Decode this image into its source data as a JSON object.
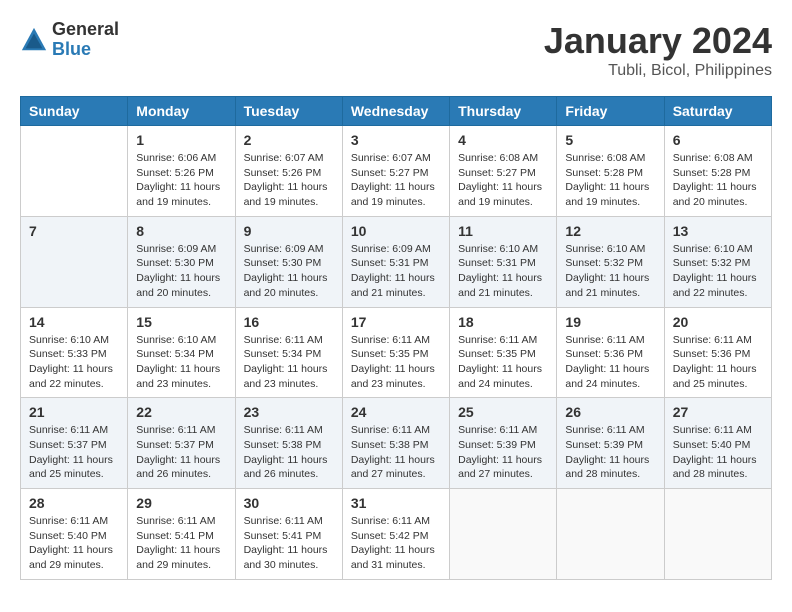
{
  "logo": {
    "general": "General",
    "blue": "Blue"
  },
  "title": {
    "month_year": "January 2024",
    "location": "Tubli, Bicol, Philippines"
  },
  "days_of_week": [
    "Sunday",
    "Monday",
    "Tuesday",
    "Wednesday",
    "Thursday",
    "Friday",
    "Saturday"
  ],
  "weeks": [
    [
      {
        "day": "",
        "sunrise": "",
        "sunset": "",
        "daylight": ""
      },
      {
        "day": "1",
        "sunrise": "Sunrise: 6:06 AM",
        "sunset": "Sunset: 5:26 PM",
        "daylight": "Daylight: 11 hours and 19 minutes."
      },
      {
        "day": "2",
        "sunrise": "Sunrise: 6:07 AM",
        "sunset": "Sunset: 5:26 PM",
        "daylight": "Daylight: 11 hours and 19 minutes."
      },
      {
        "day": "3",
        "sunrise": "Sunrise: 6:07 AM",
        "sunset": "Sunset: 5:27 PM",
        "daylight": "Daylight: 11 hours and 19 minutes."
      },
      {
        "day": "4",
        "sunrise": "Sunrise: 6:08 AM",
        "sunset": "Sunset: 5:27 PM",
        "daylight": "Daylight: 11 hours and 19 minutes."
      },
      {
        "day": "5",
        "sunrise": "Sunrise: 6:08 AM",
        "sunset": "Sunset: 5:28 PM",
        "daylight": "Daylight: 11 hours and 19 minutes."
      },
      {
        "day": "6",
        "sunrise": "Sunrise: 6:08 AM",
        "sunset": "Sunset: 5:28 PM",
        "daylight": "Daylight: 11 hours and 20 minutes."
      }
    ],
    [
      {
        "day": "7",
        "sunrise": "",
        "sunset": "",
        "daylight": ""
      },
      {
        "day": "8",
        "sunrise": "Sunrise: 6:09 AM",
        "sunset": "Sunset: 5:30 PM",
        "daylight": "Daylight: 11 hours and 20 minutes."
      },
      {
        "day": "9",
        "sunrise": "Sunrise: 6:09 AM",
        "sunset": "Sunset: 5:30 PM",
        "daylight": "Daylight: 11 hours and 20 minutes."
      },
      {
        "day": "10",
        "sunrise": "Sunrise: 6:09 AM",
        "sunset": "Sunset: 5:31 PM",
        "daylight": "Daylight: 11 hours and 21 minutes."
      },
      {
        "day": "11",
        "sunrise": "Sunrise: 6:10 AM",
        "sunset": "Sunset: 5:31 PM",
        "daylight": "Daylight: 11 hours and 21 minutes."
      },
      {
        "day": "12",
        "sunrise": "Sunrise: 6:10 AM",
        "sunset": "Sunset: 5:32 PM",
        "daylight": "Daylight: 11 hours and 21 minutes."
      },
      {
        "day": "13",
        "sunrise": "Sunrise: 6:10 AM",
        "sunset": "Sunset: 5:32 PM",
        "daylight": "Daylight: 11 hours and 22 minutes."
      }
    ],
    [
      {
        "day": "14",
        "sunrise": "Sunrise: 6:10 AM",
        "sunset": "Sunset: 5:33 PM",
        "daylight": "Daylight: 11 hours and 22 minutes."
      },
      {
        "day": "15",
        "sunrise": "Sunrise: 6:10 AM",
        "sunset": "Sunset: 5:34 PM",
        "daylight": "Daylight: 11 hours and 23 minutes."
      },
      {
        "day": "16",
        "sunrise": "Sunrise: 6:11 AM",
        "sunset": "Sunset: 5:34 PM",
        "daylight": "Daylight: 11 hours and 23 minutes."
      },
      {
        "day": "17",
        "sunrise": "Sunrise: 6:11 AM",
        "sunset": "Sunset: 5:35 PM",
        "daylight": "Daylight: 11 hours and 23 minutes."
      },
      {
        "day": "18",
        "sunrise": "Sunrise: 6:11 AM",
        "sunset": "Sunset: 5:35 PM",
        "daylight": "Daylight: 11 hours and 24 minutes."
      },
      {
        "day": "19",
        "sunrise": "Sunrise: 6:11 AM",
        "sunset": "Sunset: 5:36 PM",
        "daylight": "Daylight: 11 hours and 24 minutes."
      },
      {
        "day": "20",
        "sunrise": "Sunrise: 6:11 AM",
        "sunset": "Sunset: 5:36 PM",
        "daylight": "Daylight: 11 hours and 25 minutes."
      }
    ],
    [
      {
        "day": "21",
        "sunrise": "Sunrise: 6:11 AM",
        "sunset": "Sunset: 5:37 PM",
        "daylight": "Daylight: 11 hours and 25 minutes."
      },
      {
        "day": "22",
        "sunrise": "Sunrise: 6:11 AM",
        "sunset": "Sunset: 5:37 PM",
        "daylight": "Daylight: 11 hours and 26 minutes."
      },
      {
        "day": "23",
        "sunrise": "Sunrise: 6:11 AM",
        "sunset": "Sunset: 5:38 PM",
        "daylight": "Daylight: 11 hours and 26 minutes."
      },
      {
        "day": "24",
        "sunrise": "Sunrise: 6:11 AM",
        "sunset": "Sunset: 5:38 PM",
        "daylight": "Daylight: 11 hours and 27 minutes."
      },
      {
        "day": "25",
        "sunrise": "Sunrise: 6:11 AM",
        "sunset": "Sunset: 5:39 PM",
        "daylight": "Daylight: 11 hours and 27 minutes."
      },
      {
        "day": "26",
        "sunrise": "Sunrise: 6:11 AM",
        "sunset": "Sunset: 5:39 PM",
        "daylight": "Daylight: 11 hours and 28 minutes."
      },
      {
        "day": "27",
        "sunrise": "Sunrise: 6:11 AM",
        "sunset": "Sunset: 5:40 PM",
        "daylight": "Daylight: 11 hours and 28 minutes."
      }
    ],
    [
      {
        "day": "28",
        "sunrise": "Sunrise: 6:11 AM",
        "sunset": "Sunset: 5:40 PM",
        "daylight": "Daylight: 11 hours and 29 minutes."
      },
      {
        "day": "29",
        "sunrise": "Sunrise: 6:11 AM",
        "sunset": "Sunset: 5:41 PM",
        "daylight": "Daylight: 11 hours and 29 minutes."
      },
      {
        "day": "30",
        "sunrise": "Sunrise: 6:11 AM",
        "sunset": "Sunset: 5:41 PM",
        "daylight": "Daylight: 11 hours and 30 minutes."
      },
      {
        "day": "31",
        "sunrise": "Sunrise: 6:11 AM",
        "sunset": "Sunset: 5:42 PM",
        "daylight": "Daylight: 11 hours and 31 minutes."
      },
      {
        "day": "",
        "sunrise": "",
        "sunset": "",
        "daylight": ""
      },
      {
        "day": "",
        "sunrise": "",
        "sunset": "",
        "daylight": ""
      },
      {
        "day": "",
        "sunrise": "",
        "sunset": "",
        "daylight": ""
      }
    ]
  ]
}
